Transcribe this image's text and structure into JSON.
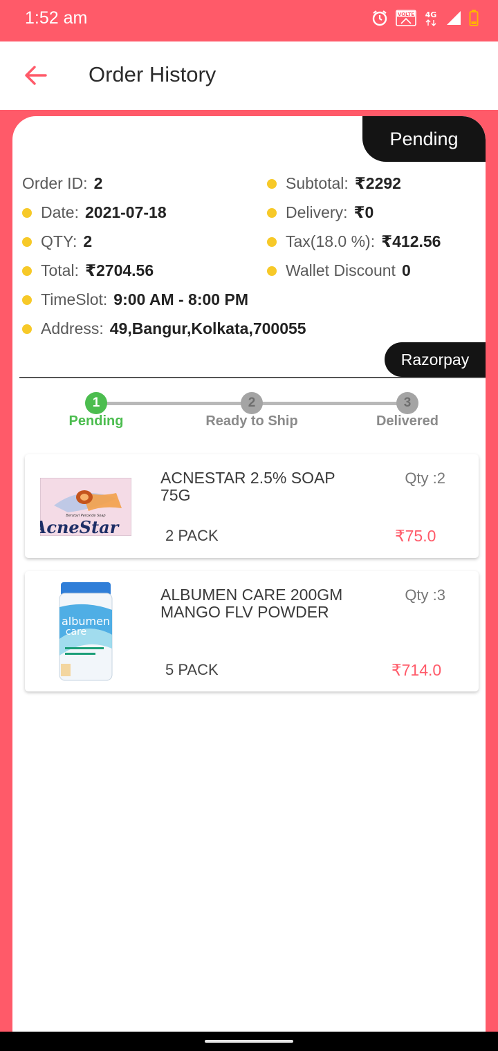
{
  "status_bar": {
    "time": "1:52 am",
    "icons": [
      "alarm-icon",
      "volte-icon",
      "4g-icon",
      "signal-icon",
      "battery-icon"
    ],
    "volte_label": "VOLTE",
    "network_label": "4G"
  },
  "header": {
    "title": "Order History",
    "back_icon": "arrow-left-icon"
  },
  "order": {
    "status": "Pending",
    "payment_method": "Razorpay",
    "fields": {
      "order_id": {
        "label": "Order ID:",
        "value": "2"
      },
      "date": {
        "label": "Date:",
        "value": "2021-07-18"
      },
      "qty": {
        "label": "QTY:",
        "value": "2"
      },
      "total": {
        "label": "Total:",
        "value": "₹2704.56"
      },
      "timeslot": {
        "label": "TimeSlot:",
        "value": "9:00 AM - 8:00 PM"
      },
      "address": {
        "label": "Address:",
        "value": "49,Bangur,Kolkata,700055"
      },
      "subtotal": {
        "label": "Subtotal:",
        "value": "₹2292"
      },
      "delivery": {
        "label": "Delivery:",
        "value": "₹0"
      },
      "tax": {
        "label": "Tax(18.0 %):",
        "value": "₹412.56"
      },
      "wallet_discount": {
        "label": "Wallet Discount",
        "value": "0"
      }
    }
  },
  "stepper": {
    "steps": [
      {
        "number": "1",
        "label": "Pending",
        "active": true
      },
      {
        "number": "2",
        "label": "Ready to Ship",
        "active": false
      },
      {
        "number": "3",
        "label": "Delivered",
        "active": false
      }
    ]
  },
  "items": [
    {
      "name": " ACNESTAR 2.5% SOAP 75G",
      "qty": "Qty :2",
      "pack": "2 PACK",
      "price": "₹75.0",
      "image_text_brand": "AcneStar",
      "image_text_sub": "Benzoyl Peroxide Soap"
    },
    {
      "name": " ALBUMEN CARE 200GM MANGO FLV POWDER",
      "qty": "Qty :3",
      "pack": "5 PACK",
      "price": "₹714.0",
      "image_text_brand": "albumen",
      "image_text_sub": "care"
    }
  ],
  "colors": {
    "accent": "#ff5a69",
    "dot": "#f7c928",
    "step_active": "#4cbd4f",
    "dark_pill": "#141414"
  }
}
